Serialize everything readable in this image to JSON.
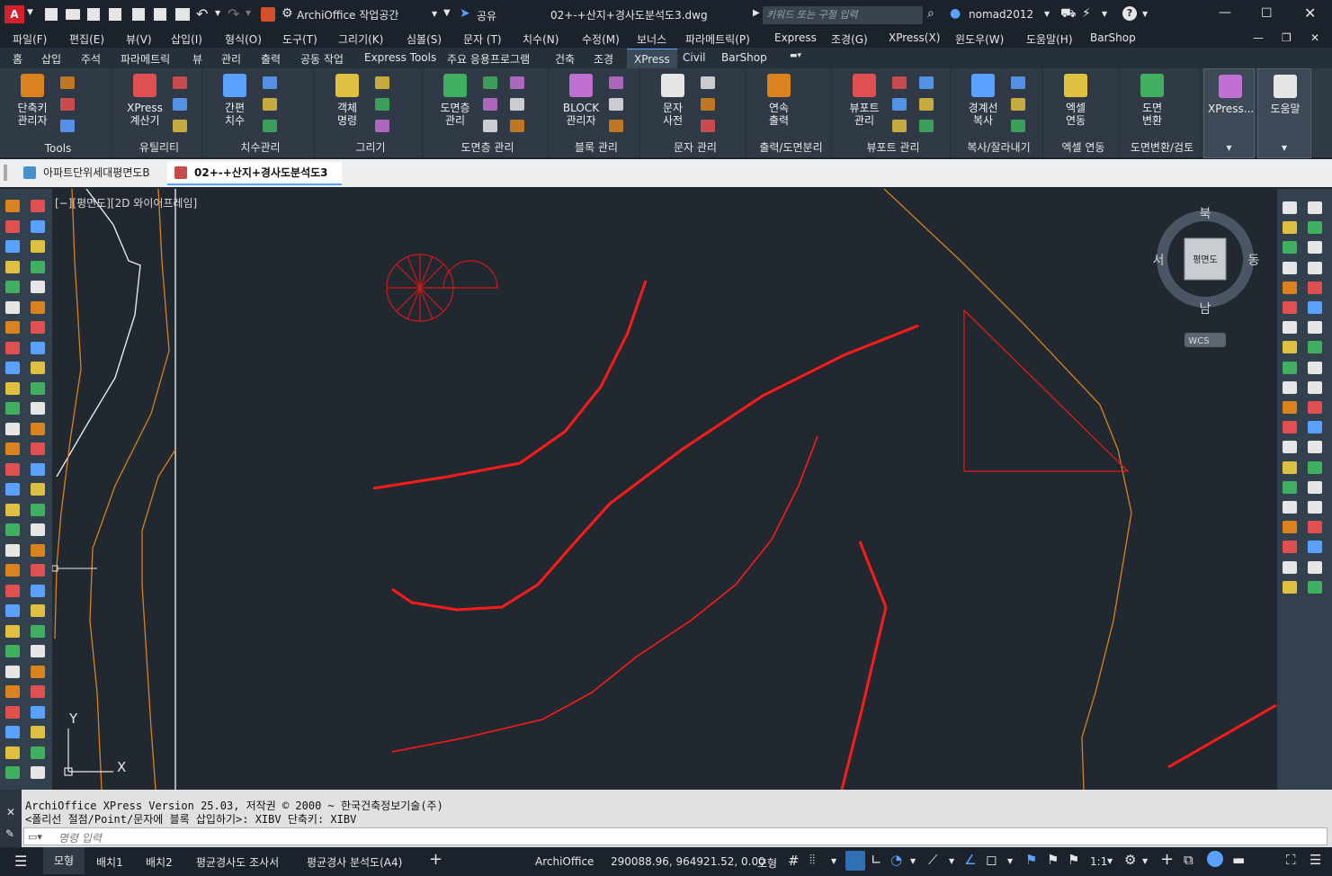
{
  "title_bar": {
    "app_badge": "A",
    "workspace": "ArchiOffice 작업공간",
    "share": "공유",
    "filename": "02+-+산지+경사도분석도3.dwg",
    "search_placeholder": "키워드 또는 구절 입력",
    "username": "nomad2012"
  },
  "menu": [
    "파일(F)",
    "편집(E)",
    "뷰(V)",
    "삽입(I)",
    "형식(O)",
    "도구(T)",
    "그리기(K)",
    "심볼(S)",
    "문자 (T)",
    "치수(N)",
    "수정(M)",
    "보너스",
    "파라메트릭(P)",
    "Express",
    "조경(G)",
    "XPress(X)",
    "윈도우(W)",
    "도움말(H)",
    "BarShop"
  ],
  "ribbon_tabs": [
    "홈",
    "삽입",
    "주석",
    "파라메트릭",
    "뷰",
    "관리",
    "출력",
    "공동 작업",
    "Express Tools",
    "주요 응용프로그램",
    "건축",
    "조경",
    "XPress",
    "Civil",
    "BarShop"
  ],
  "active_ribbon_tab": "XPress",
  "ribbon_groups": [
    {
      "label": "Tools",
      "big": "단축키\n관리자"
    },
    {
      "label": "유틸리티",
      "big": "XPress\n계산기"
    },
    {
      "label": "치수관리",
      "big": "간편\n치수"
    },
    {
      "label": "그리기",
      "big": "객체\n명령"
    },
    {
      "label": "도면층 관리",
      "big": "도면층\n관리"
    },
    {
      "label": "블록 관리",
      "big": "BLOCK\n관리자"
    },
    {
      "label": "문자 관리",
      "big": "문자\n사전"
    },
    {
      "label": "출력/도면분리",
      "big": "연속\n출력"
    },
    {
      "label": "뷰포트 관리",
      "big": "뷰포트\n관리"
    },
    {
      "label": "복사/잘라내기",
      "big": "경계선\n복사"
    },
    {
      "label": "엑셀 연동",
      "big": "엑셀\n연동"
    },
    {
      "label": "도면변환/검토",
      "big": "도면\n변환"
    },
    {
      "label": "",
      "big": "XPress..."
    },
    {
      "label": "",
      "big": "도움말"
    }
  ],
  "doc_tabs": [
    "아파트단위세대평면도B",
    "02+-+산지+경사도분석도3"
  ],
  "viewport_label": "[−][평면도][2D 와이어프레임]",
  "viewcube": {
    "north": "북",
    "south": "남",
    "east": "동",
    "west": "서",
    "face": "평면도",
    "wcs": "WCS"
  },
  "ucs": {
    "x": "X",
    "y": "Y"
  },
  "command_history": [
    "ArchiOffice XPress Version 25.03, 저작권 © 2000 ~ 한국건축정보기술(주)",
    "<폴리선 절점/Point/문자에 블록 삽입하기>: XIBV  단축키: XIBV"
  ],
  "command_placeholder": "명령 입력",
  "layout_tabs": [
    "모형",
    "배치1",
    "배치2",
    "평균경사도 조사서",
    "평균경사 분석도(A4)"
  ],
  "status": {
    "app": "ArchiOffice",
    "coords": "290088.96, 964921.52, 0.00",
    "mode": "모형",
    "scale": "1:1"
  },
  "colors": {
    "accent": "#5aa0ff",
    "red_line": "#ff1a1a",
    "orange_line": "#d9821e",
    "app_red": "#d4202a"
  }
}
